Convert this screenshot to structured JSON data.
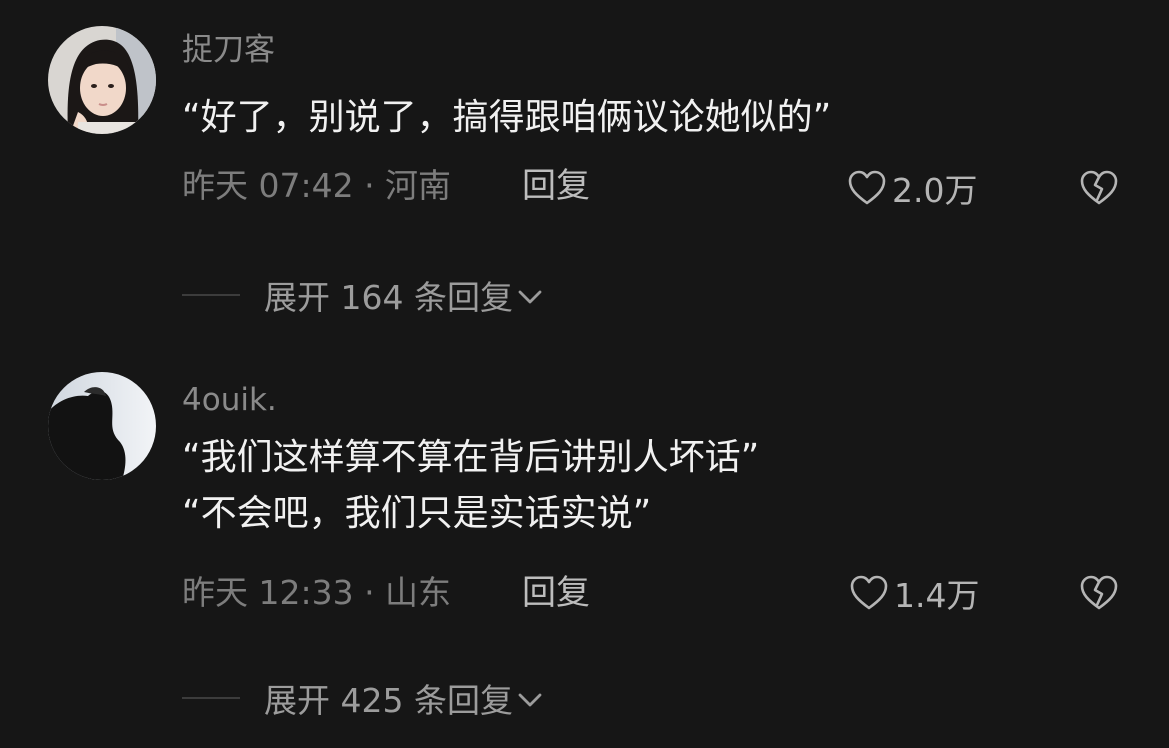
{
  "comments": [
    {
      "username": "捉刀客",
      "text_lines": [
        "“好了，别说了，搞得跟咱俩议论她似的”"
      ],
      "time_location": "昨天 07:42 · 河南",
      "reply_label": "回复",
      "likes": "2.0万",
      "expand_label": "展开 164 条回复"
    },
    {
      "username": "4ouik.",
      "text_lines": [
        "“我们这样算不算在背后讲别人坏话”",
        "“不会吧，我们只是实话实说”"
      ],
      "time_location": "昨天 12:33 · 山东",
      "reply_label": "回复",
      "likes": "1.4万",
      "expand_label": "展开 425 条回复"
    }
  ],
  "icons": {
    "like": "heart-outline-icon",
    "dislike": "broken-heart-icon",
    "expand": "chevron-down-icon"
  },
  "colors": {
    "background": "#161616",
    "text": "#f1f1f1",
    "meta": "#7d7d7d"
  }
}
